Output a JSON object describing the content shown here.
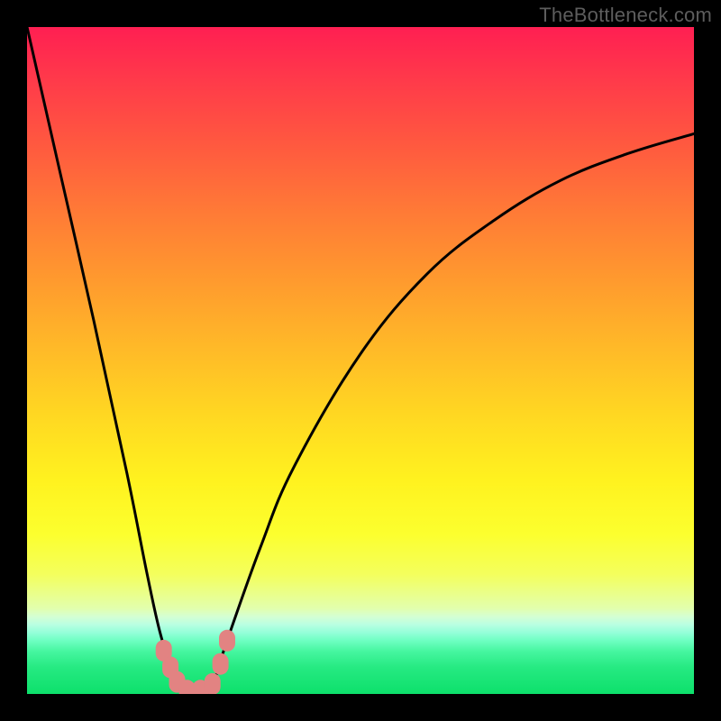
{
  "watermark": "TheBottleneck.com",
  "colors": {
    "frame": "#000000",
    "curve": "#000000",
    "markers": "#e28382",
    "gradient_top": "#ff1f52",
    "gradient_bottom": "#0de06b"
  },
  "chart_data": {
    "type": "line",
    "title": "",
    "xlabel": "",
    "ylabel": "",
    "xlim": [
      0,
      100
    ],
    "ylim": [
      0,
      100
    ],
    "note": "V-shaped bottleneck curve on rainbow gradient; minimum near x≈25; no visible axis ticks or labels.",
    "series": [
      {
        "name": "bottleneck-curve",
        "x": [
          0,
          5,
          10,
          15,
          18,
          20,
          22,
          24,
          26,
          28,
          30,
          35,
          40,
          50,
          60,
          70,
          80,
          90,
          100
        ],
        "y": [
          100,
          78,
          56,
          33,
          18,
          9,
          3,
          0,
          0,
          2,
          8,
          22,
          34,
          51,
          63,
          71,
          77,
          81,
          84
        ]
      }
    ],
    "markers": [
      {
        "x": 20.5,
        "y": 6.5
      },
      {
        "x": 21.5,
        "y": 4.0
      },
      {
        "x": 22.5,
        "y": 1.8
      },
      {
        "x": 24.0,
        "y": 0.5
      },
      {
        "x": 26.0,
        "y": 0.5
      },
      {
        "x": 27.8,
        "y": 1.5
      },
      {
        "x": 29.0,
        "y": 4.5
      },
      {
        "x": 30.0,
        "y": 8.0
      }
    ]
  }
}
